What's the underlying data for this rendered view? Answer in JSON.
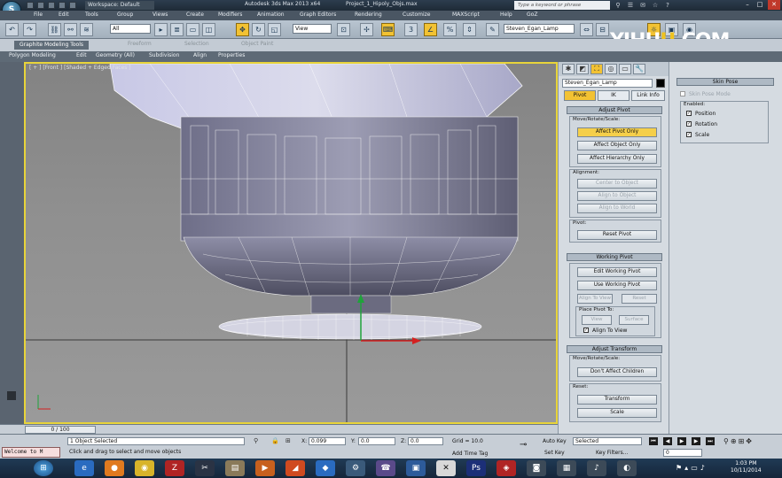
{
  "title_bar": {
    "workspace": "Workspace: Default",
    "app_title": "Autodesk 3ds Max 2013 x64",
    "project": "Project_1_Hipoly_Objs.max",
    "search_placeholder": "Type a keyword or phrase"
  },
  "menu": [
    "File",
    "Edit",
    "Tools",
    "Group",
    "Views",
    "Create",
    "Modifiers",
    "Animation",
    "Graph Editors",
    "Rendering",
    "Customize",
    "MAXScript",
    "Help",
    "GoZ"
  ],
  "toolbar": {
    "selection_filter": "All",
    "ref_coord": "View",
    "named_selection": "Steven_Egan_Lamp"
  },
  "watermark": {
    "prefix": "YIHU",
    "accent": "U",
    "suffix": ".COM"
  },
  "ribbon": {
    "tabs": [
      "Graphite Modeling Tools",
      "Freeform",
      "Selection",
      "Object Paint"
    ],
    "subtabs": [
      "Polygon Modeling",
      "Edit",
      "Geometry (All)",
      "Subdivision",
      "Align",
      "Properties"
    ]
  },
  "viewport": {
    "label": "[ + ] [Front ] [Shaded + Edged Faces ]"
  },
  "command_panel": {
    "object_name": "Steven_Egan_Lamp",
    "hierarchy_tabs": [
      "Pivot",
      "IK",
      "Link Info"
    ],
    "adjust_pivot": {
      "title": "Adjust Pivot",
      "move_rotate_scale": "Move/Rotate/Scale:",
      "buttons": [
        "Affect Pivot Only",
        "Affect Object Only",
        "Affect Hierarchy Only"
      ],
      "alignment_label": "Alignment:",
      "alignment_buttons": [
        "Center to Object",
        "Align to Object",
        "Align to World"
      ],
      "pivot_label": "Pivot:",
      "reset_pivot": "Reset Pivot"
    },
    "working_pivot": {
      "title": "Working Pivot",
      "buttons": [
        "Edit Working Pivot",
        "Use Working Pivot"
      ],
      "align_to_view": "Align To View",
      "reset": "Reset",
      "place_pivot_to": "Place Pivot To:",
      "view": "View",
      "surface": "Surface",
      "align_to_view_check": "Align To View"
    },
    "adjust_transform": {
      "title": "Adjust Transform",
      "move_rotate_scale": "Move/Rotate/Scale:",
      "dont_affect": "Don't Affect Children",
      "reset_label": "Reset:",
      "transform": "Transform",
      "scale": "Scale"
    }
  },
  "skin_pose": {
    "title": "Skin Pose",
    "skin_pose_mode": "Skin Pose Mode",
    "enabled": "Enabled:",
    "checks": [
      "Position",
      "Rotation",
      "Scale"
    ]
  },
  "time_slider": {
    "frame": "0 / 100"
  },
  "status": {
    "selected": "1 Object Selected",
    "prompt": "Click and drag to select and move objects",
    "x": "0.099",
    "y": "0.0",
    "z": "0.0",
    "grid": "Grid = 10.0",
    "add_time_tag": "Add Time Tag",
    "auto_key": "Auto Key",
    "set_key": "Set Key",
    "key_selected": "Selected",
    "key_filters": "Key Filters...",
    "frame_field": "0",
    "maxscript": "Welcome to M"
  },
  "taskbar": {
    "time": "1:03 PM",
    "date": "10/11/2014"
  }
}
